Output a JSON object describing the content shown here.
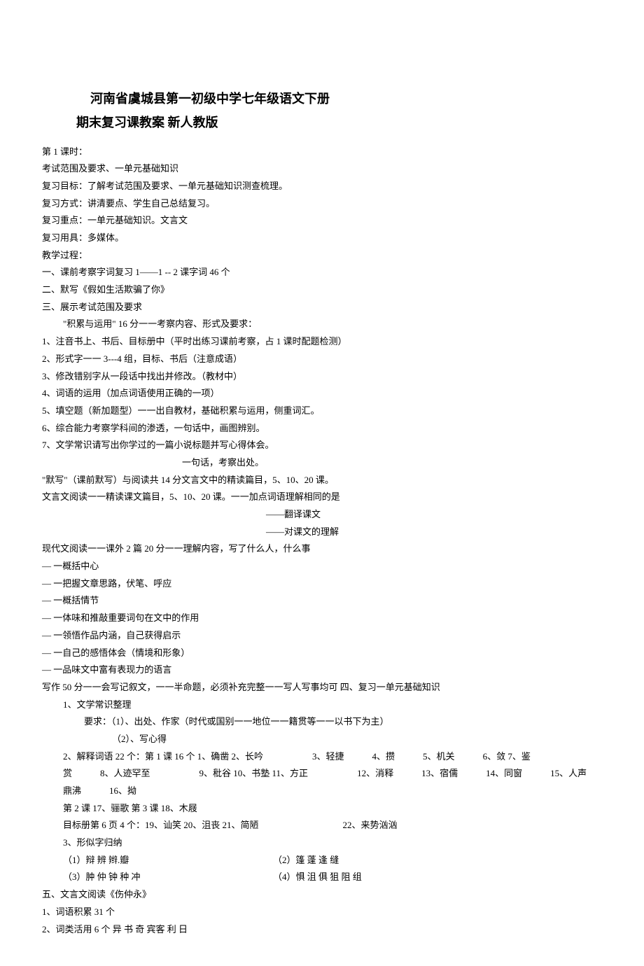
{
  "title": {
    "part1": "河南省虞城县第一初级中学七年级语文下册",
    "part2": "期末复习课教案 新人教版"
  },
  "lines": {
    "l1": "第 1 课时：",
    "l2": "考试范围及要求、一单元基础知识",
    "l3": "复习目标：了解考试范围及要求、一单元基础知识测查梳理。",
    "l4": "复习方式：讲清要点、学生自己总结复习。",
    "l5": "复习重点：一单元基础知识。文言文",
    "l6": "复习用具：多媒体。",
    "l7": "教学过程：",
    "l8": "一、课前考察字词复习 1——1 -- 2 课字词 46 个",
    "l9": "二、默写《假如生活欺骗了你》",
    "l10": "三、展示考试范围及要求",
    "l11": "\"积累与运用\"  16 分一一考察内容、形式及要求：",
    "l12": "1、注音书上、书后、目标册中（平时出练习课前考察，占 1 课时配题检测）",
    "l13": "2、形式字一一 3---4 组，目标、书后（注意成语）",
    "l14": "3、修改错别字从一段话中找出并修改。（教材中）",
    "l15": "4、词语的运用（加点词语使用正确的一项）",
    "l16": "5、填空题（新加题型）一一出自教材，基础积累与运用，侧重词汇。",
    "l17": "6、综合能力考察学科间的渗透，一句话中，画图辨别。",
    "l18": "7、文学常识请写出你学过的一篇小说标题并写心得体会。",
    "l19": "一句话，考察出处。",
    "l20": "\"默写\"（课前默写）与阅读共 14 分文言文中的精读篇目，5、10、20 课。",
    "l21": "文言文阅读一一精读课文篇目，5、10、20 课。一一加点词语理解相同的是",
    "l22": "——翻译课文",
    "l23": "——对课文的理解",
    "l24": "现代文阅读一一课外 2 篇 20 分一一理解内容，写了什么人，什么事",
    "l25": "— 一概括中心",
    "l26": "— 一把握文章思路，伏笔、呼应",
    "l27": "— 一概括情节",
    "l28": "— 一体味和推敲重要词句在文中的作用",
    "l29": "— 一领悟作品内涵，自己获得启示",
    "l30": "— 一自己的感悟体会（情境和形象）",
    "l31": "— 一品味文中富有表现力的语言",
    "l32": "写作 50 分一一会写记叙文，一一半命题，必须补充完整一一写人写事均可 四、复习一单元基础知识",
    "l33": "1、文学常识整理",
    "l34": "要求：（1）、出处、作家（时代或国别一一地位一一籍贯等一一以书下为主）",
    "l35": "（2）、写心得",
    "vocab1_a": "2、解释词语 22 个：第 1 课 16 个 1、确凿 2、长吟",
    "vocab1_b": "3、轻捷",
    "vocab1_c": "4、攒",
    "vocab1_d": "5、机关",
    "vocab1_e": "6、敛 7、鉴",
    "vocab2_a": "赏",
    "vocab2_b": "8、人迹罕至",
    "vocab2_c": "9、秕谷 10、书塾 11、方正",
    "vocab2_d": "12、消释",
    "vocab2_e": "13、宿儒",
    "vocab2_f": "14、同窗",
    "vocab2_g": "15、人声",
    "vocab3_a": "鼎沸",
    "vocab3_b": "16、拗",
    "l36": "第 2 课 17、骊歌 第 3 课 18、木屐",
    "l37a": "目标册第 6 页 4 个：19、讪笑 20、沮丧 21、简陋",
    "l37b": "22、来势汹汹",
    "l38": "3、形似字归纳",
    "l39a": "（1）辩 辨 辫.瓣",
    "l39b": "（2）篷    蓬    逢       缝",
    "l40a": "（3）肿 仲 钟 种 冲",
    "l40b": "（4）惧    沮    俱    狙       阻 组",
    "l41": "五、文言文阅读《伤仲永》",
    "l42": "1、词语积累 31 个",
    "l43": "2、词类活用 6 个 异 书 奇 宾客 利 日"
  }
}
